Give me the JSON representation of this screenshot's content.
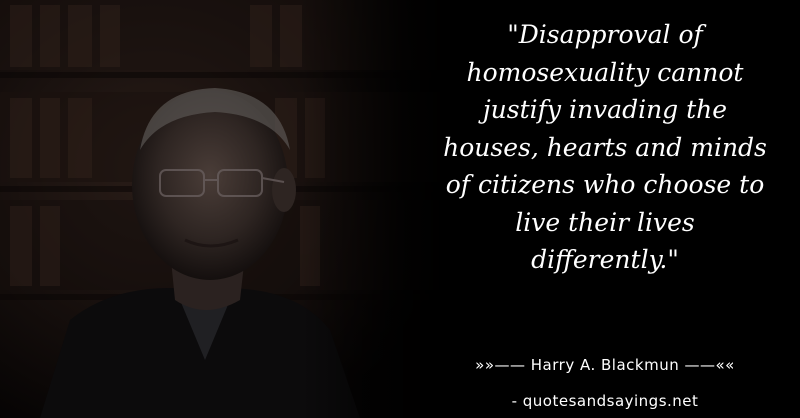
{
  "quote": {
    "lines": [
      "\"Disapproval of",
      "homosexuality cannot",
      "justify invading the",
      "houses, hearts and minds",
      "of citizens who choose to",
      "live their lives",
      "differently.\""
    ]
  },
  "author": {
    "text": "»»—— Harry A. Blackmun ——««"
  },
  "source": {
    "text": "- quotesandsayings.net"
  },
  "colors": {
    "background": "#000000",
    "text": "#ffffff"
  }
}
